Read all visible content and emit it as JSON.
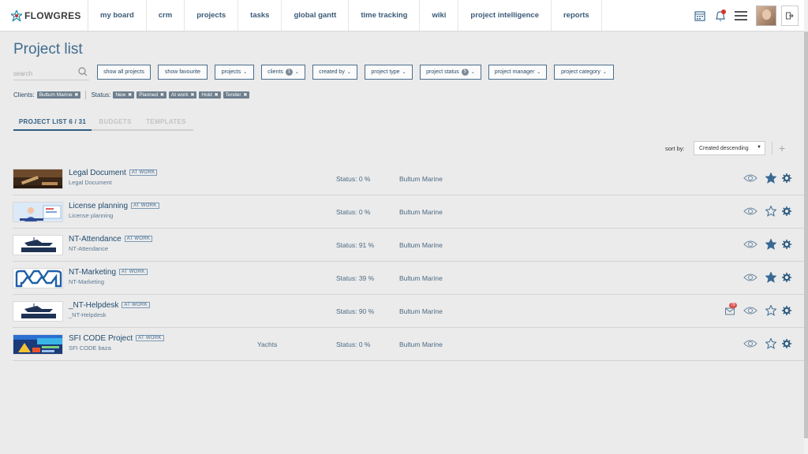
{
  "nav": {
    "logo_text": "FLOWGRES",
    "items": [
      {
        "label": "my board"
      },
      {
        "label": "crm"
      },
      {
        "label": "projects"
      },
      {
        "label": "tasks"
      },
      {
        "label": "global gantt"
      },
      {
        "label": "time tracking"
      },
      {
        "label": "wiki"
      },
      {
        "label": "project intelligence"
      },
      {
        "label": "reports"
      }
    ],
    "icons": [
      "calendar-icon",
      "bell-icon",
      "menu-icon",
      "avatar",
      "logout-icon"
    ]
  },
  "page": {
    "title": "Project list",
    "search_placeholder": "search"
  },
  "filters": {
    "show_all": "show all projects",
    "show_favourite": "show favourite",
    "projects": "projects",
    "clients": "clients",
    "clients_count": "1",
    "created_by": "created by",
    "project_type": "project type",
    "project_status": "project status",
    "project_status_count": "5",
    "project_manager": "project manager",
    "project_category": "project category"
  },
  "active_filters": {
    "clients_label": "Clients:",
    "clients": [
      "Bultum Marine"
    ],
    "status_label": "Status:",
    "statuses": [
      "New",
      "Planned",
      "At work",
      "Hold",
      "Tender"
    ]
  },
  "tabs": [
    {
      "label": "PROJECT LIST 6 / 31",
      "active": true
    },
    {
      "label": "BUDGETS",
      "active": false
    },
    {
      "label": "TEMPLATES",
      "active": false
    }
  ],
  "sort": {
    "label": "sort by:",
    "value": "Created descending"
  },
  "projects": [
    {
      "name": "Legal Document",
      "tag": "AT WORK",
      "sub": "Legal Document",
      "extra": "",
      "status": "Status: 0 %",
      "client": "Bultum Marine",
      "favourite": true,
      "mail_count": ""
    },
    {
      "name": "License planning",
      "tag": "AT WORK",
      "sub": "License planning",
      "extra": "",
      "status": "Status: 0 %",
      "client": "Bultum Marine",
      "favourite": false,
      "mail_count": ""
    },
    {
      "name": "NT-Attendance",
      "tag": "AT WORK",
      "sub": "NT-Attendance",
      "extra": "",
      "status": "Status: 91 %",
      "client": "Bultum Marine",
      "favourite": true,
      "mail_count": ""
    },
    {
      "name": "NT-Marketing",
      "tag": "AT WORK",
      "sub": "NT-Marketing",
      "extra": "",
      "status": "Status: 39 %",
      "client": "Bultum Marine",
      "favourite": true,
      "mail_count": ""
    },
    {
      "name": "_NT-Helpdesk",
      "tag": "AT WORK",
      "sub": "_NT-Helpdesk",
      "extra": "",
      "status": "Status: 90 %",
      "client": "Bultum Marine",
      "favourite": false,
      "mail_count": "79"
    },
    {
      "name": "SFI CODE Project",
      "tag": "AT WORK",
      "sub": "SFI CODE baza",
      "extra": "Yachts",
      "status": "Status: 0 %",
      "client": "Bultum Marine",
      "favourite": false,
      "mail_count": ""
    }
  ],
  "colors": {
    "accent": "#2e5d82",
    "chip": "#6e7f8e",
    "badge_red": "#d9534f",
    "star": "#3a6a93"
  }
}
